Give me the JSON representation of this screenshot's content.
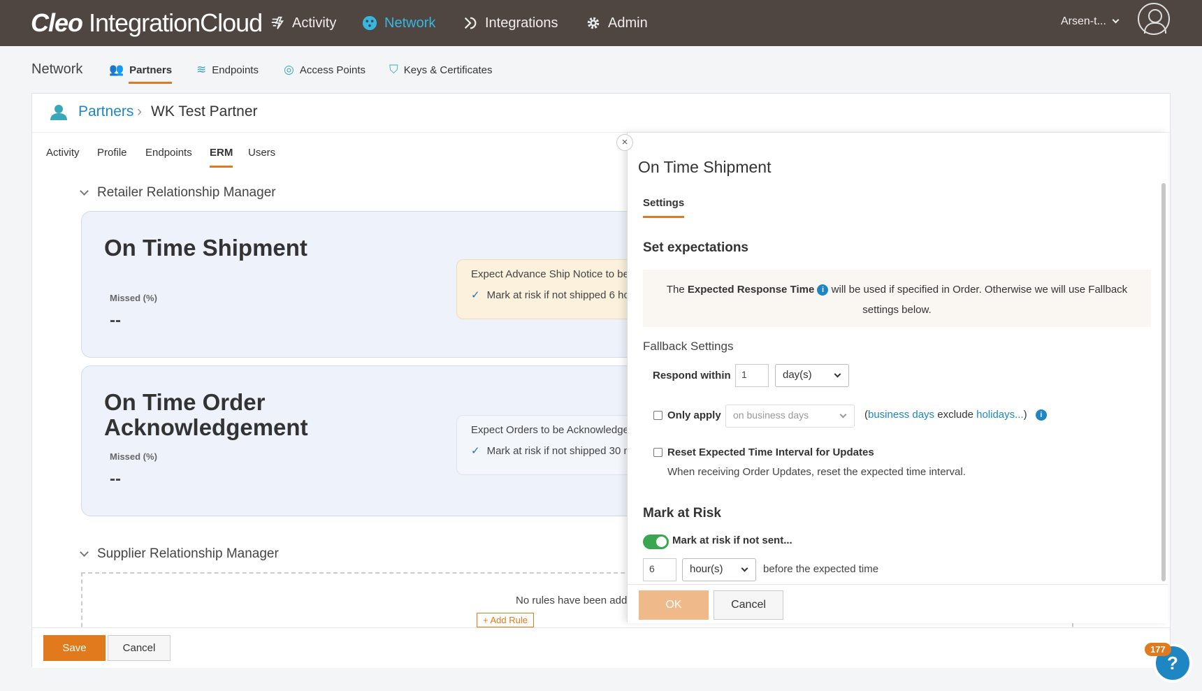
{
  "app": {
    "logo_bold": "Cleo",
    "logo_rest": " IntegrationCloud",
    "nav": [
      {
        "label": "Activity",
        "icon": "activity-icon"
      },
      {
        "label": "Network",
        "icon": "network-icon",
        "active": true
      },
      {
        "label": "Integrations",
        "icon": "integrations-icon"
      },
      {
        "label": "Admin",
        "icon": "gear-icon"
      }
    ],
    "user": "Arsen-t..."
  },
  "subnav": {
    "title": "Network",
    "tabs": [
      {
        "label": "Partners",
        "active": true
      },
      {
        "label": "Endpoints"
      },
      {
        "label": "Access Points"
      },
      {
        "label": "Keys & Certificates"
      }
    ]
  },
  "breadcrumb": {
    "parent": "Partners",
    "sep": "›",
    "current": "WK Test Partner"
  },
  "partner_tabs": [
    "Activity",
    "Profile",
    "Endpoints",
    "ERM",
    "Users"
  ],
  "retailer": {
    "heading": "Retailer Relationship Manager",
    "rules": [
      {
        "title": "On Time Shipment",
        "missed_label": "Missed (%)",
        "missed_value": "--",
        "expect": "Expect Advance Ship Notice to be",
        "check": "Mark at risk if not shipped 6 ho"
      },
      {
        "title_line1": "On Time Order",
        "title_line2": "Acknowledgement",
        "missed_label": "Missed (%)",
        "missed_value": "--",
        "expect": "Expect Orders to be Acknowledged",
        "check": "Mark at risk if not shipped 30 m"
      }
    ]
  },
  "supplier": {
    "heading": "Supplier Relationship Manager",
    "empty": "No rules have been added",
    "add_rule": "Add Rule"
  },
  "footer": {
    "save": "Save",
    "cancel": "Cancel"
  },
  "panel": {
    "close": "×",
    "title": "On Time Shipment",
    "tab": "Settings",
    "set_expectations": "Set expectations",
    "info_pre": "The ",
    "info_bold": "Expected Response Time",
    "info_post": " will be used if specified in Order. Otherwise we will use Fallback settings below.",
    "fallback": "Fallback Settings",
    "respond_within": "Respond within",
    "respond_value": "1",
    "respond_unit": "day(s)",
    "only_apply": "Only apply",
    "only_apply_option": "on business days",
    "bd_open": "(",
    "bd_link": "business days",
    "bd_mid": " exclude ",
    "holidays_link": "holidays...",
    "bd_close": ")",
    "reset_label": "Reset Expected Time Interval for Updates",
    "reset_desc": "When receiving Order Updates, reset the expected time interval.",
    "mark_at_risk": "Mark at Risk",
    "mark_toggle_label": "Mark at risk if not sent...",
    "risk_value": "6",
    "risk_unit": "hour(s)",
    "risk_suffix": "before the expected time",
    "ok": "OK",
    "cancel": "Cancel"
  },
  "help": {
    "badge": "177",
    "icon": "?"
  }
}
